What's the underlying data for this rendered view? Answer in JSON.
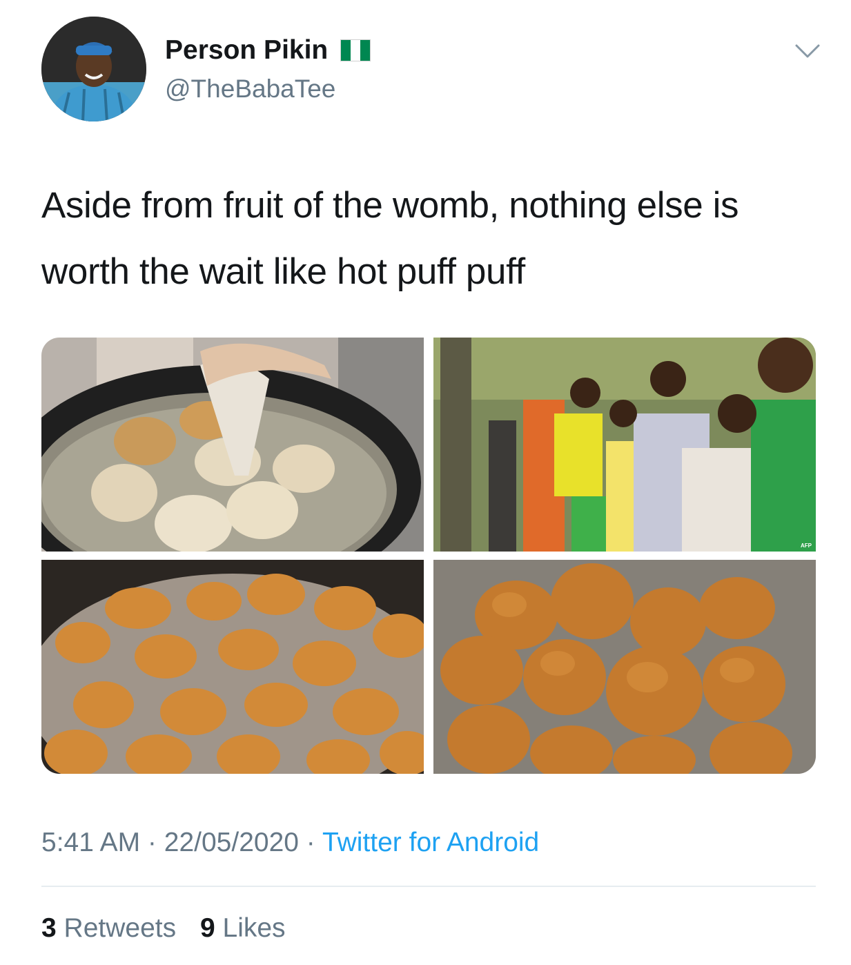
{
  "author": {
    "display_name": "Person Pikin",
    "handle": "@TheBabaTee",
    "flag_colors": [
      "#008751",
      "#ffffff",
      "#008751"
    ],
    "avatar_icon": "profile-photo"
  },
  "menu_icon": "chevron-down-icon",
  "tweet": {
    "text": "Aside from fruit of the womb, nothing else is worth the wait like hot puff puff"
  },
  "media": [
    {
      "description_icon": "frying-dough-photo"
    },
    {
      "description_icon": "queue-of-people-photo",
      "watermark": "AFP"
    },
    {
      "description_icon": "frying-puff-puff-photo"
    },
    {
      "description_icon": "puff-puff-basket-photo"
    }
  ],
  "meta": {
    "time": "5:41 AM",
    "separator": " · ",
    "date": "22/05/2020",
    "source": "Twitter for Android"
  },
  "stats": {
    "retweets_count": "3",
    "retweets_label": "Retweets",
    "likes_count": "9",
    "likes_label": "Likes"
  },
  "colors": {
    "text": "#14171a",
    "secondary": "#657786",
    "link": "#1da1f2",
    "divider": "#e6ecf0"
  }
}
